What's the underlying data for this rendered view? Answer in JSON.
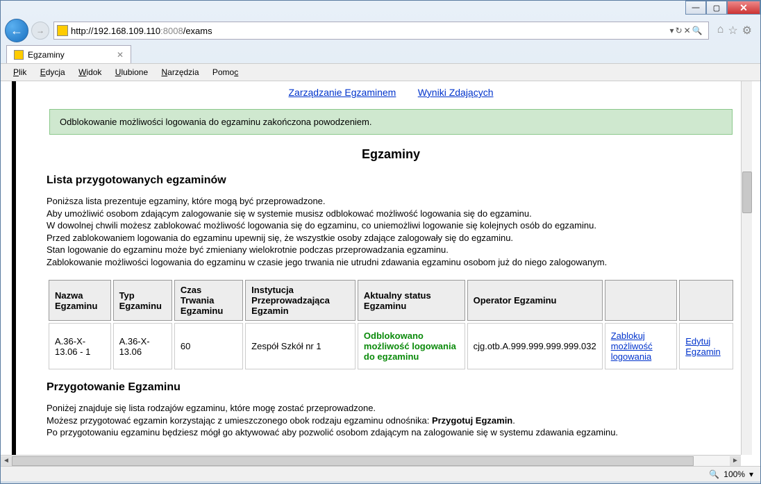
{
  "window": {
    "url_prefix": "http://",
    "url_host": "192.168.109.110",
    "url_port": ":8008",
    "url_path": "/exams",
    "tab_title": "Egzaminy"
  },
  "menu": {
    "plik": "Plik",
    "edycja": "Edycja",
    "widok": "Widok",
    "ulubione": "Ulubione",
    "narzedzia": "Narzędzia",
    "pomoc": "Pomoc"
  },
  "topnav": {
    "link1": "Zarządzanie Egzaminem",
    "link2": "Wyniki Zdających"
  },
  "alert": {
    "success": "Odblokowanie możliwości logowania do egzaminu zakończona powodzeniem."
  },
  "page": {
    "title": "Egzaminy",
    "list_title": "Lista przygotowanych egzaminów",
    "desc1": "Poniższa lista prezentuje egzaminy, które mogą być przeprowadzone.",
    "desc2": "Aby umożliwić osobom zdającym zalogowanie się w systemie musisz odblokować możliwość logowania się do egzaminu.",
    "desc3": "W dowolnej chwili możesz zablokować możliwość logowania się do egzaminu, co uniemożliwi logowanie się kolejnych osób do egzaminu.",
    "desc4": "Przed zablokowaniem logowania do egzaminu upewnij się, że wszystkie osoby zdające zalogowały się do egzaminu.",
    "desc5": "Stan logowanie do egzaminu może być zmieniany wielokrotnie podczas przeprowadzania egzaminu.",
    "desc6": "Zablokowanie możliwości logowania do egzaminu w czasie jego trwania nie utrudni zdawania egzaminu osobom już do niego zalogowanym.",
    "prep_title": "Przygotowanie Egzaminu",
    "prep1": "Poniżej znajduje się lista rodzajów egzaminu, które mogę zostać przeprowadzone.",
    "prep2a": "Możesz przygotować egzamin korzystając z umieszczonego obok rodzaju egzaminu odnośnika: ",
    "prep2b": "Przygotuj Egzamin",
    "prep2c": ".",
    "prep3": "Po przygotowaniu egzaminu będziesz mógł go aktywować aby pozwolić osobom zdającym na zalogowanie się w systemu zdawania egzaminu."
  },
  "table": {
    "headers": {
      "name": "Nazwa Egzaminu",
      "type": "Typ Egzaminu",
      "duration": "Czas Trwania Egzaminu",
      "institution": "Instytucja Przeprowadzająca Egzamin",
      "status": "Aktualny status Egzaminu",
      "operator": "Operator Egzaminu"
    },
    "row": {
      "name": "A.36-X-13.06 - 1",
      "type": "A.36-X-13.06",
      "duration": "60",
      "institution": "Zespół Szkół nr 1",
      "status": "Odblokowano możliwość logowania do egzaminu",
      "operator": "cjg.otb.A.999.999.999.999.032",
      "action1": "Zablokuj możliwość logowania",
      "action2": "Edytuj Egzamin"
    }
  },
  "statusbar": {
    "zoom": "100%"
  }
}
